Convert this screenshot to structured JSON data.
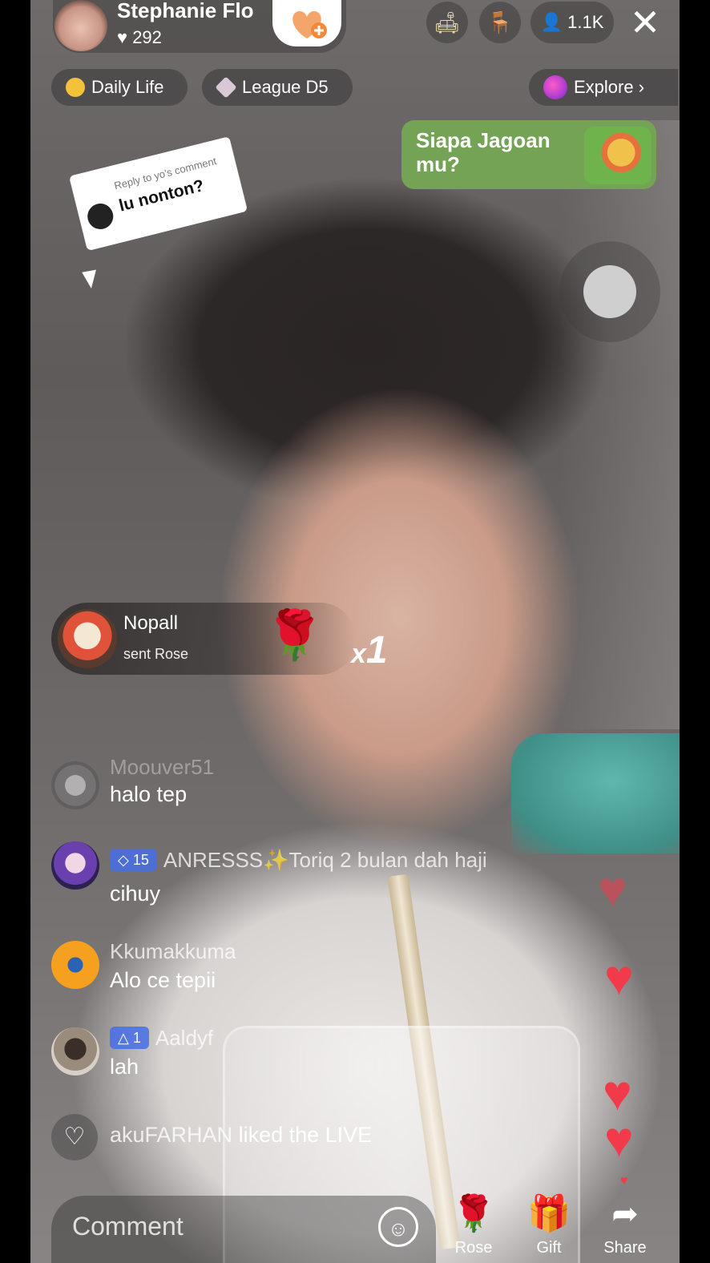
{
  "host": {
    "name": "Stephanie Flo",
    "likes": "292"
  },
  "viewers": "1.1K",
  "chips": [
    {
      "label": "Daily Life",
      "icon": "hashtag-icon"
    },
    {
      "label": "League D5",
      "icon": "diamond-icon"
    },
    {
      "label": "Explore",
      "icon": "planet-icon"
    }
  ],
  "promo": {
    "text": "Siapa Jagoan mu?"
  },
  "reply": {
    "prefix": "Reply to yo's comment",
    "text": "lu nonton?"
  },
  "gift": {
    "user": "Nopall",
    "action": "sent Rose",
    "count": "1",
    "multiplier": "x"
  },
  "chat": [
    {
      "name": "Moouver51",
      "message": "halo tep"
    },
    {
      "badge": "15",
      "name": "ANRESSS✨Toriq 2 bulan dah haji",
      "message": "cihuy"
    },
    {
      "name": "Kkumakkuma",
      "message": "Alo ce tepii"
    },
    {
      "badge": "1",
      "name": "Aaldyf",
      "message": "lah"
    }
  ],
  "liked": {
    "user": "akuFARHAN",
    "text": "liked the LIVE"
  },
  "bottom": {
    "comment_placeholder": "Comment",
    "rose_label": "Rose",
    "gift_label": "Gift",
    "share_label": "Share"
  },
  "colors": {
    "heart": "#f23a4a",
    "promo_bg": "#74a355",
    "badge": "#466ee6"
  }
}
